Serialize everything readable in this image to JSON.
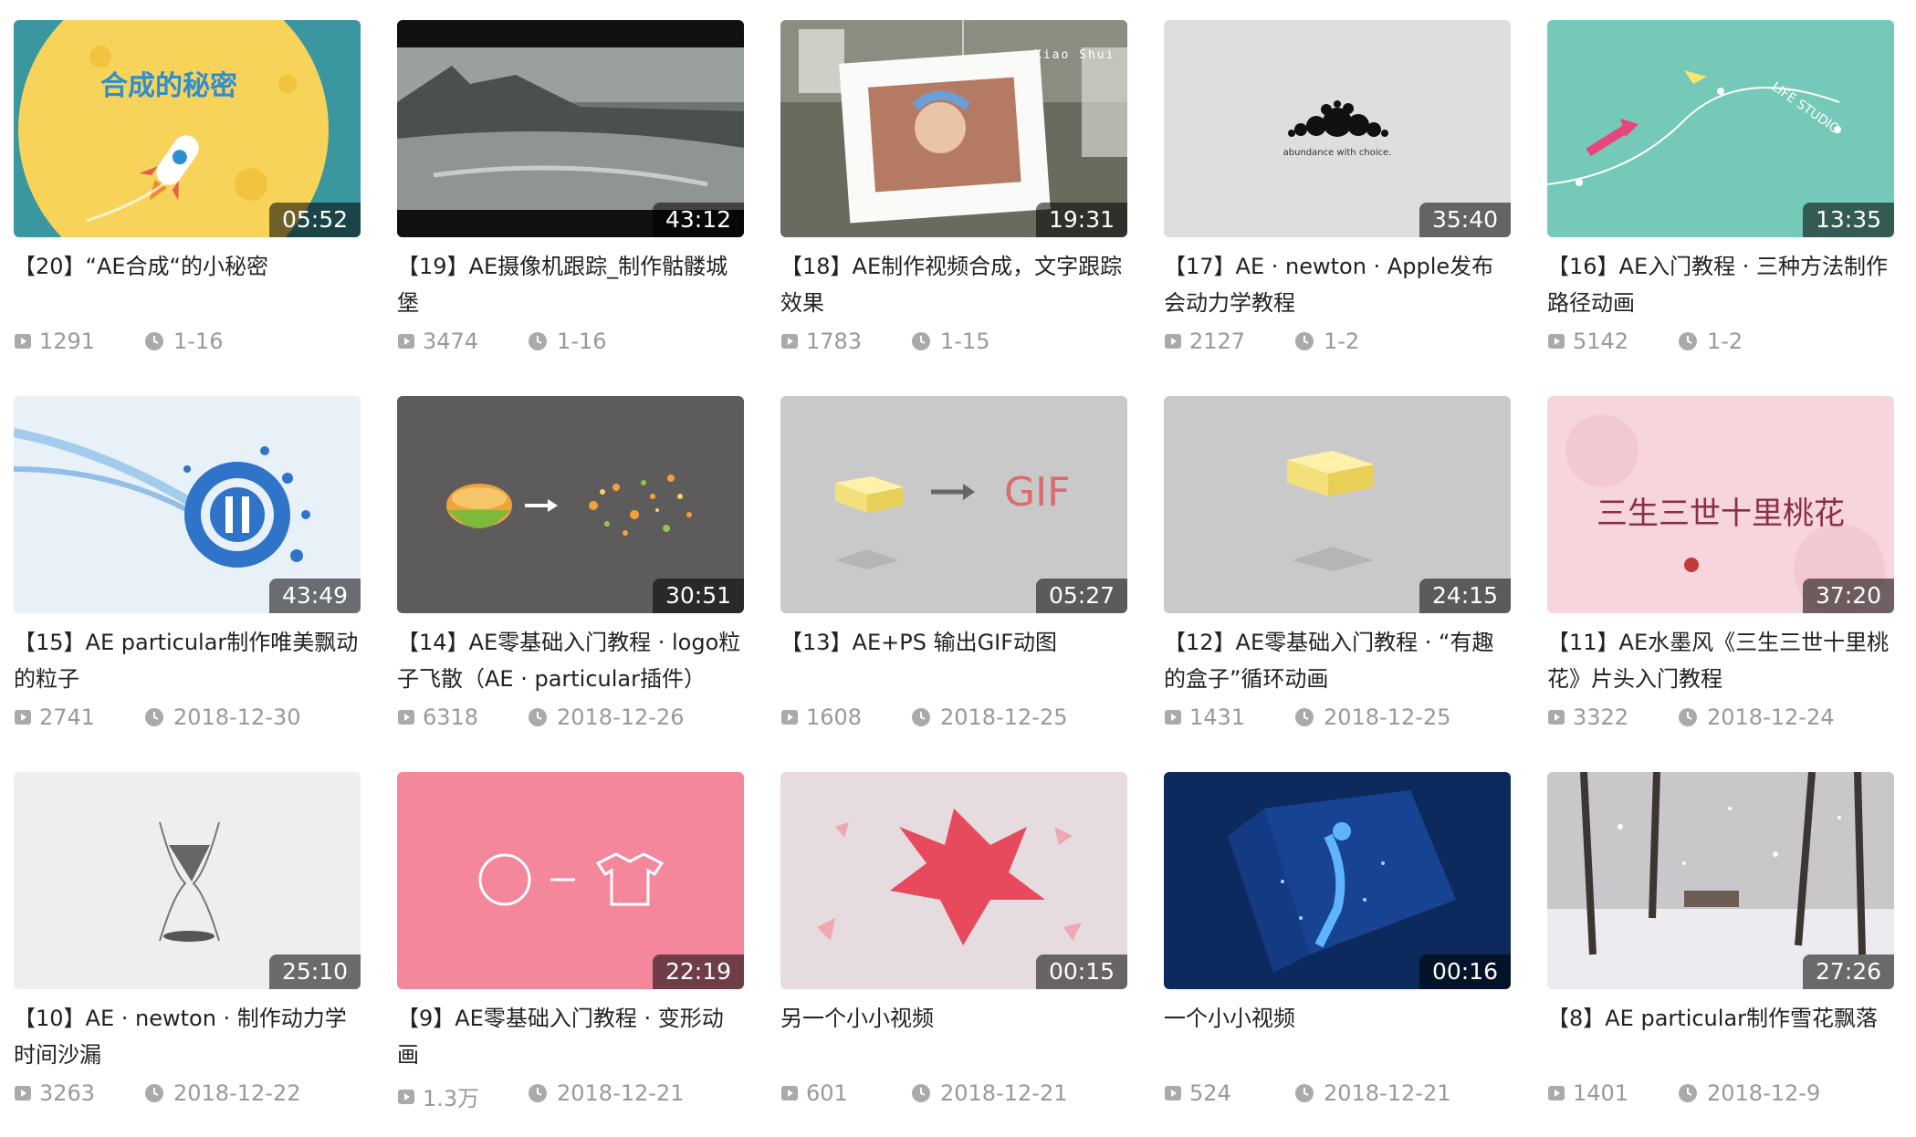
{
  "videos": [
    {
      "duration": "05:52",
      "title": "【20】“AE合成“的小秘密",
      "plays": "1291",
      "date": "1-16",
      "thumb": "moon"
    },
    {
      "duration": "43:12",
      "title": "【19】AE摄像机跟踪_制作骷髅城堡",
      "plays": "3474",
      "date": "1-16",
      "thumb": "coast"
    },
    {
      "duration": "19:31",
      "title": "【18】AE制作视频合成，文字跟踪效果",
      "plays": "1783",
      "date": "1-15",
      "thumb": "frame",
      "overlay": "Xiao Shui"
    },
    {
      "duration": "35:40",
      "title": "【17】AE · newton · Apple发布会动力学教程",
      "plays": "2127",
      "date": "1-2",
      "thumb": "bubbles",
      "overlay": "abundance with choice."
    },
    {
      "duration": "13:35",
      "title": "【16】AE入门教程 · 三种方法制作路径动画",
      "plays": "5142",
      "date": "1-2",
      "thumb": "path",
      "overlay": "LIFE STUDIO"
    },
    {
      "duration": "43:49",
      "title": "【15】AE particular制作唯美飘动的粒子",
      "plays": "2741",
      "date": "2018-12-30",
      "thumb": "particles-blue"
    },
    {
      "duration": "30:51",
      "title": "【14】AE零基础入门教程 · logo粒子飞散（AE · particular插件）",
      "plays": "6318",
      "date": "2018-12-26",
      "thumb": "orange"
    },
    {
      "duration": "05:27",
      "title": "【13】AE+PS 输出GIF动图",
      "plays": "1608",
      "date": "2018-12-25",
      "thumb": "gif",
      "overlay": "GIF"
    },
    {
      "duration": "24:15",
      "title": "【12】AE零基础入门教程 · “有趣的盒子”循环动画",
      "plays": "1431",
      "date": "2018-12-25",
      "thumb": "box"
    },
    {
      "duration": "37:20",
      "title": "【11】AE水墨风《三生三世十里桃花》片头入门教程",
      "plays": "3322",
      "date": "2018-12-24",
      "thumb": "ink",
      "overlay": "三生三世十里桃花"
    },
    {
      "duration": "25:10",
      "title": "【10】AE · newton · 制作动力学时间沙漏",
      "plays": "3263",
      "date": "2018-12-22",
      "thumb": "hourglass"
    },
    {
      "duration": "22:19",
      "title": "【9】AE零基础入门教程 · 变形动画",
      "plays": "1.3万",
      "date": "2018-12-21",
      "thumb": "morph"
    },
    {
      "duration": "00:15",
      "title": "另一个小小视频",
      "plays": "601",
      "date": "2018-12-21",
      "thumb": "poly"
    },
    {
      "duration": "00:16",
      "title": "一个小小视频",
      "plays": "524",
      "date": "2018-12-21",
      "thumb": "cube"
    },
    {
      "duration": "27:26",
      "title": "【8】AE particular制作雪花飘落",
      "plays": "1401",
      "date": "2018-12-9",
      "thumb": "snow"
    }
  ],
  "moon_text": "合成的秘密"
}
